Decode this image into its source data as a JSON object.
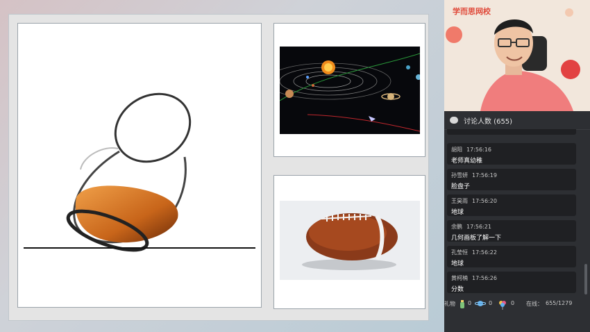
{
  "brand": {
    "label": "学而思网校"
  },
  "chat": {
    "title": "讨论人数 (655)",
    "messages": [
      {
        "user": "",
        "time": "",
        "text": ""
      },
      {
        "user": "胡阳",
        "time": "17:56:16",
        "text": "老师真幼稚"
      },
      {
        "user": "孙雪妍",
        "time": "17:56:19",
        "text": "脸盘子"
      },
      {
        "user": "王昊雨",
        "time": "17:56:20",
        "text": "地球"
      },
      {
        "user": "余鹏",
        "time": "17:56:21",
        "text": "几何画板了解一下"
      },
      {
        "user": "孔莹恒",
        "time": "17:56:22",
        "text": "地球"
      },
      {
        "user": "黄柯楠",
        "time": "17:56:26",
        "text": "分数"
      }
    ]
  },
  "footer": {
    "gift_label": "礼物",
    "gift1_count": "0",
    "gift2_count": "0",
    "gift3_count": "0",
    "online_label": "在线：",
    "online_value": "655/1279"
  },
  "colors": {
    "chat_bg": "#2d2f33",
    "brand": "#e04a3a"
  },
  "icons": [
    "chat-bubble-icon",
    "bottle-gift-icon",
    "planet-gift-icon",
    "balloon-gift-icon"
  ]
}
